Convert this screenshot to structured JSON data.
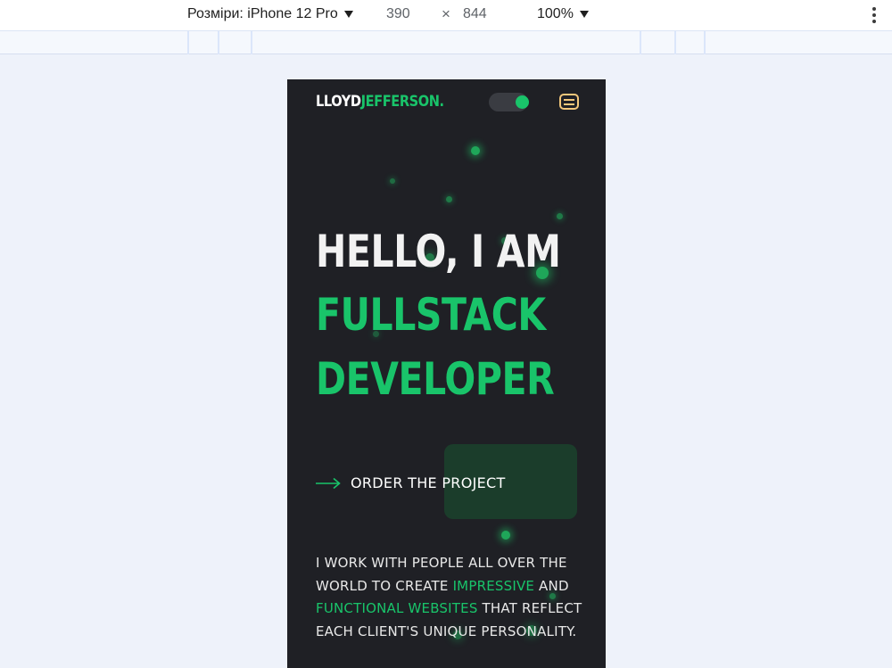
{
  "devtools": {
    "device_label": "Розміри: iPhone 12 Pro",
    "width": "390",
    "times": "×",
    "height": "844",
    "zoom": "100%"
  },
  "site": {
    "logo_part1": "LLOYD",
    "logo_part2": "JEFFERSON.",
    "hero_line1": "HELLO, I AM",
    "hero_line2": "FULLSTACK",
    "hero_line3": "DEVELOPER",
    "cta_label": "ORDER THE PROJECT",
    "about": {
      "part1": "I WORK WITH PEOPLE ALL OVER THE WORLD TO CREATE ",
      "highlight1": "IMPRESSIVE",
      "part2": " AND ",
      "highlight2": "FUNCTIONAL WEBSITES",
      "part3": " THAT REFLECT EACH CLIENT'S UNIQUE PERSONALITY."
    }
  },
  "colors": {
    "accent": "#19c46a",
    "background": "#1f2025",
    "menu_icon": "#f3c77b"
  },
  "icons": [
    "chevron-down-icon",
    "kebab-menu-icon",
    "theme-toggle-icon",
    "hamburger-menu-icon",
    "arrow-right-icon"
  ]
}
